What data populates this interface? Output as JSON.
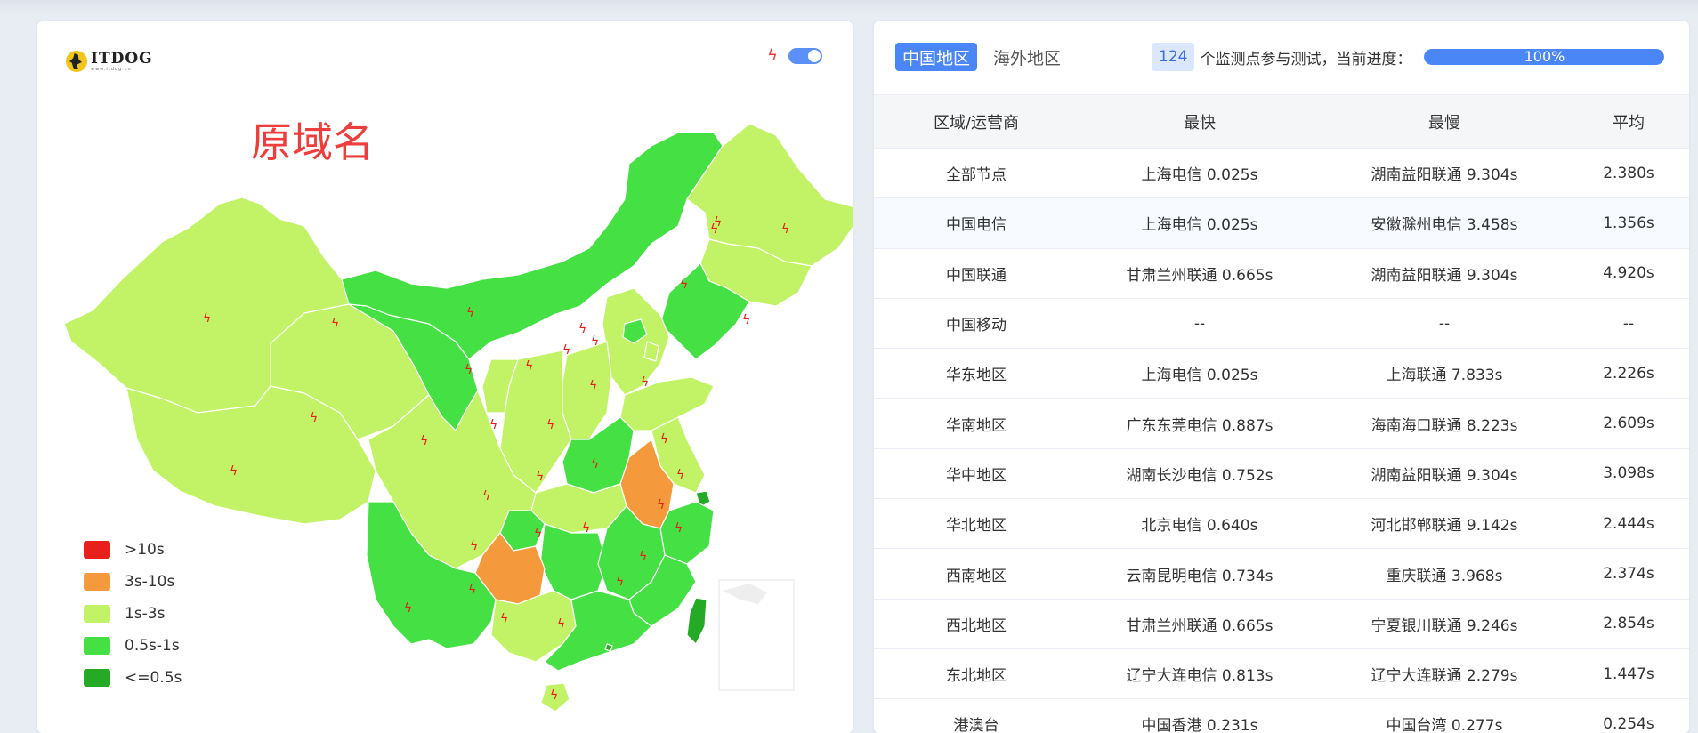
{
  "logo": {
    "main": "ITDOG",
    "sub": "www.itdog.cn"
  },
  "map": {
    "title": "原域名",
    "legend": [
      {
        "label": ">10s",
        "color": "#e8201c"
      },
      {
        "label": "3s-10s",
        "color": "#f59a3c"
      },
      {
        "label": "1s-3s",
        "color": "#c2f366"
      },
      {
        "label": "0.5s-1s",
        "color": "#45e043"
      },
      {
        "label": "<=0.5s",
        "color": "#25aa25"
      }
    ]
  },
  "tabs": [
    {
      "label": "中国地区",
      "active": true
    },
    {
      "label": "海外地区",
      "active": false
    }
  ],
  "probe": {
    "count": "124",
    "text": "个监测点参与测试，当前进度：",
    "progress_label": "100%",
    "progress_percent": 100
  },
  "table": {
    "headers": [
      "区域/运营商",
      "最快",
      "最慢",
      "平均"
    ],
    "rows": [
      [
        "全部节点",
        "上海电信 0.025s",
        "湖南益阳联通 9.304s",
        "2.380s"
      ],
      [
        "中国电信",
        "上海电信 0.025s",
        "安徽滁州电信 3.458s",
        "1.356s"
      ],
      [
        "中国联通",
        "甘肃兰州联通 0.665s",
        "湖南益阳联通 9.304s",
        "4.920s"
      ],
      [
        "中国移动",
        "--",
        "--",
        "--"
      ],
      [
        "华东地区",
        "上海电信 0.025s",
        "上海联通 7.833s",
        "2.226s"
      ],
      [
        "华南地区",
        "广东东莞电信 0.887s",
        "海南海口联通 8.223s",
        "2.609s"
      ],
      [
        "华中地区",
        "湖南长沙电信 0.752s",
        "湖南益阳联通 9.304s",
        "3.098s"
      ],
      [
        "华北地区",
        "北京电信 0.640s",
        "河北邯郸联通 9.142s",
        "2.444s"
      ],
      [
        "西南地区",
        "云南昆明电信 0.734s",
        "重庆联通 3.968s",
        "2.374s"
      ],
      [
        "西北地区",
        "甘肃兰州联通 0.665s",
        "宁夏银川联通 9.246s",
        "2.854s"
      ],
      [
        "东北地区",
        "辽宁大连电信 0.813s",
        "辽宁大连联通 2.279s",
        "1.447s"
      ],
      [
        "港澳台",
        "中国香港 0.231s",
        "中国台湾 0.277s",
        "0.254s"
      ]
    ]
  }
}
